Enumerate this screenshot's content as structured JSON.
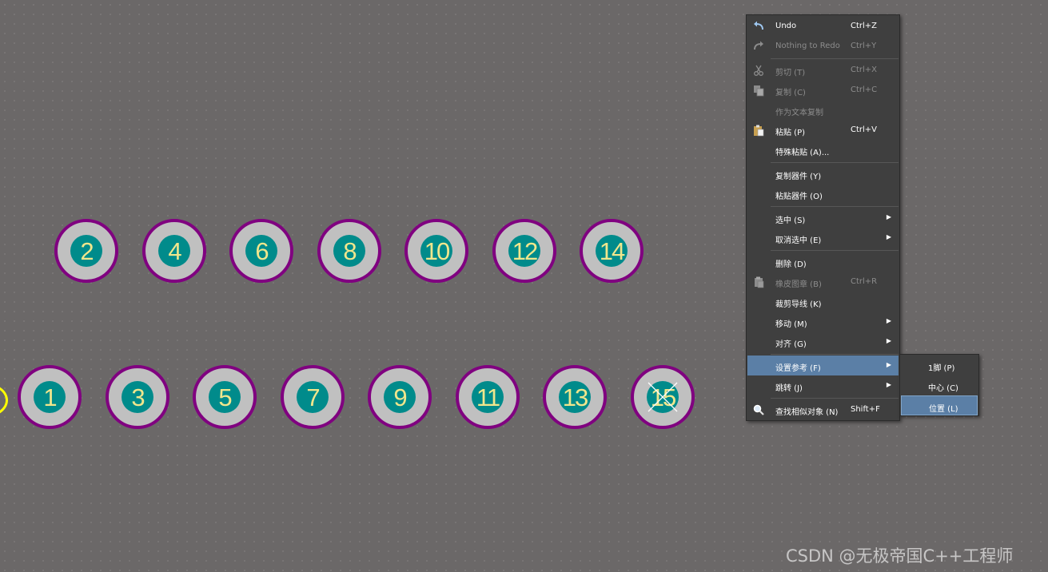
{
  "pads": {
    "top_row": [
      "2",
      "4",
      "6",
      "8",
      "10",
      "12",
      "14"
    ],
    "bottom_row": [
      "1",
      "3",
      "5",
      "7",
      "9",
      "11",
      "13",
      "15"
    ],
    "selected_pad": "15"
  },
  "colors": {
    "canvas_background": "#6b6868",
    "pad_ring": "#800080",
    "pad_body": "#c0c0c0",
    "pad_hole": "#008b8b",
    "pad_text": "#f0e68c",
    "origin_marker": "#ffff00",
    "menu_background": "#3f3f3f",
    "menu_highlight": "#5b7fa6",
    "menu_disabled_text": "#8c8c8c"
  },
  "context_menu": {
    "undo": {
      "label": "Undo",
      "shortcut": "Ctrl+Z",
      "icon": "undo-icon"
    },
    "redo": {
      "label": "Nothing to Redo",
      "shortcut": "Ctrl+Y",
      "icon": "redo-icon"
    },
    "cut": {
      "label": "剪切 (T)",
      "shortcut": "Ctrl+X",
      "icon": "scissors-icon"
    },
    "copy": {
      "label": "复制 (C)",
      "shortcut": "Ctrl+C",
      "icon": "copy-icon"
    },
    "copy_as_text": {
      "label": "作为文本复制"
    },
    "paste": {
      "label": "粘贴 (P)",
      "shortcut": "Ctrl+V",
      "icon": "paste-icon"
    },
    "paste_special": {
      "label": "特殊粘贴 (A)..."
    },
    "copy_component": {
      "label": "复制器件 (Y)"
    },
    "paste_component": {
      "label": "粘贴器件 (O)"
    },
    "select": {
      "label": "选中 (S)"
    },
    "deselect": {
      "label": "取消选中 (E)"
    },
    "delete": {
      "label": "删除 (D)"
    },
    "rubber_stamp": {
      "label": "橡皮图章 (B)",
      "shortcut": "Ctrl+R",
      "icon": "rubber-stamp-icon"
    },
    "break_track": {
      "label": "裁剪导线 (K)"
    },
    "move": {
      "label": "移动 (M)"
    },
    "align": {
      "label": "对齐 (G)"
    },
    "set_reference": {
      "label": "设置参考 (F)"
    },
    "jump": {
      "label": "跳转 (J)"
    },
    "find_similar": {
      "label": "查找相似对象 (N)",
      "shortcut": "Shift+F",
      "icon": "search-icon"
    },
    "submenu_arrow": "▶"
  },
  "reference_submenu": {
    "pin1": {
      "label": "1脚 (P)"
    },
    "center": {
      "label": "中心 (C)"
    },
    "location": {
      "label": "位置 (L)"
    }
  },
  "watermark": "CSDN @无极帝国C++工程师"
}
